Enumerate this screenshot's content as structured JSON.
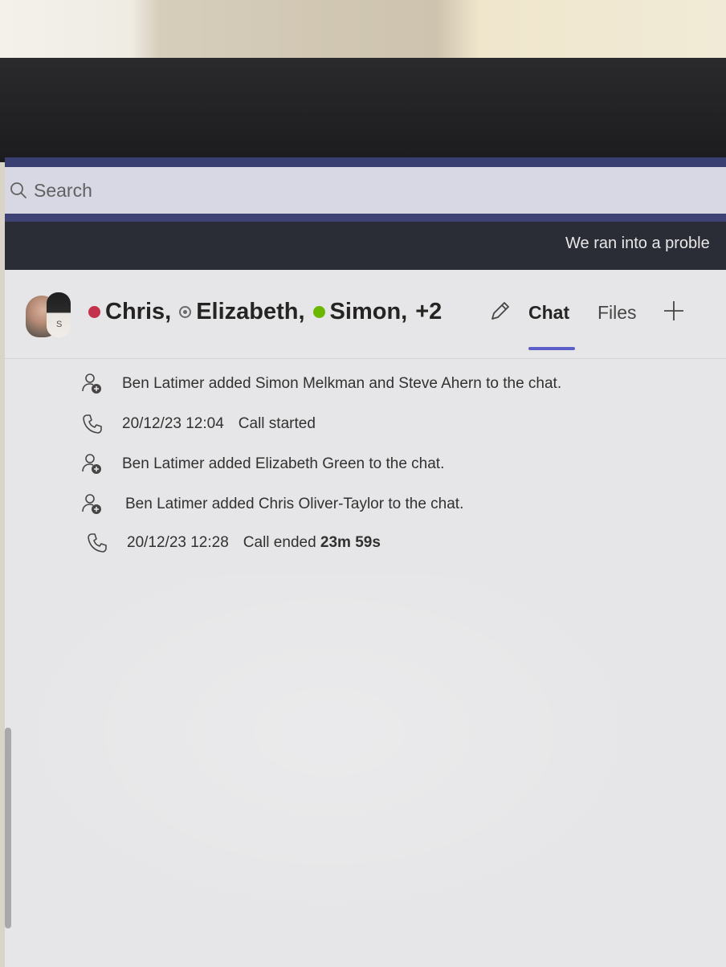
{
  "search": {
    "placeholder": "Search"
  },
  "banner": {
    "text": "We ran into a proble"
  },
  "chat": {
    "avatar_initial": "S",
    "participants": [
      {
        "name": "Chris,",
        "status": "busy",
        "status_color": "#c4314b"
      },
      {
        "name": "Elizabeth,",
        "status": "away",
        "status_color": "#6b6b6b"
      },
      {
        "name": "Simon,",
        "status": "available",
        "status_color": "#6bb700"
      },
      {
        "name": "+2",
        "status": "",
        "status_color": ""
      }
    ],
    "tabs": {
      "chat": "Chat",
      "files": "Files"
    }
  },
  "events": [
    {
      "icon": "person-add-icon",
      "timestamp": "",
      "text": "Ben Latimer added Simon Melkman and Steve Ahern to the chat.",
      "bold": ""
    },
    {
      "icon": "phone-icon",
      "timestamp": "20/12/23 12:04",
      "text": "Call started",
      "bold": ""
    },
    {
      "icon": "person-add-icon",
      "timestamp": "",
      "text": "Ben Latimer added Elizabeth Green to the chat.",
      "bold": ""
    },
    {
      "icon": "person-add-icon",
      "timestamp": "",
      "text": "Ben Latimer added Chris Oliver-Taylor to the chat.",
      "bold": ""
    },
    {
      "icon": "phone-icon",
      "timestamp": "20/12/23 12:28",
      "text": "Call ended",
      "bold": "23m 59s"
    }
  ],
  "colors": {
    "accent": "#5b5fc7",
    "titlebar": "#3a3f72",
    "banner": "#2a2d36"
  }
}
